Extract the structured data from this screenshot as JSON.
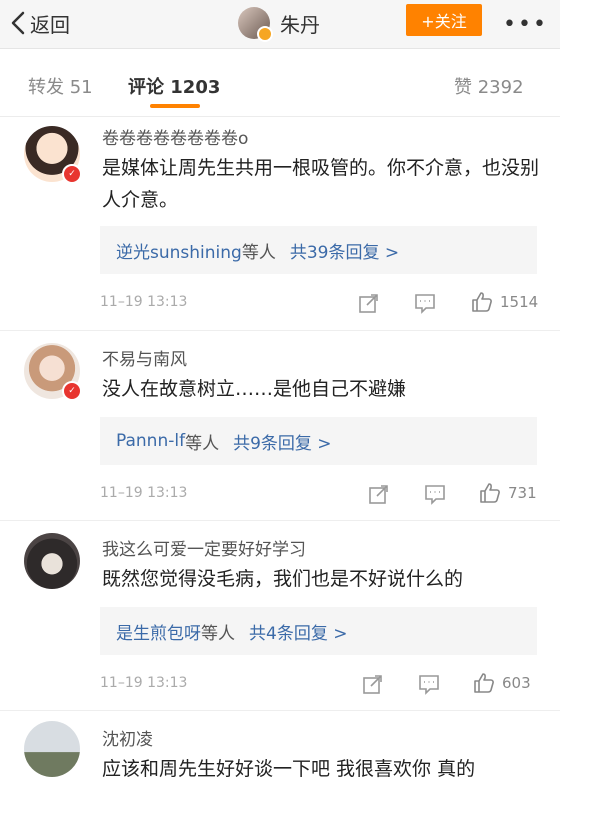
{
  "header": {
    "back_label": "返回",
    "title": "朱丹",
    "follow_label": "+关注",
    "more_label": "•••"
  },
  "tabs": [
    {
      "label": "转发 51"
    },
    {
      "label": "评论 1203"
    },
    {
      "label": "赞 2392"
    }
  ],
  "comments": [
    {
      "name": "卷卷卷卷卷卷卷卷o",
      "text": "是媒体让周先生共用一根吸管的。你不介意，也没别人介意。",
      "reply_users": "逆光sunshining",
      "reply_mid": "等人",
      "reply_count": "共39条回复 >",
      "time": "11–19 13:13",
      "likes": "1514"
    },
    {
      "name": "不易与南风",
      "text": "没人在故意树立……是他自己不避嫌",
      "reply_users": "Pannn-lf",
      "reply_mid": "等人",
      "reply_count": "共9条回复 >",
      "time": "11–19 13:13",
      "likes": "731"
    },
    {
      "name": "我这么可爱一定要好好学习",
      "text": "既然您觉得没毛病，我们也是不好说什么的",
      "reply_users": "是生煎包呀",
      "reply_mid": "等人",
      "reply_count": "共4条回复 >",
      "time": "11–19 13:13",
      "likes": "603"
    },
    {
      "name": "沈初凌",
      "text": "应该和周先生好好谈一下吧  我很喜欢你  真的"
    }
  ],
  "colors": {
    "accent": "#ff8200",
    "link": "#3b6aa8"
  }
}
